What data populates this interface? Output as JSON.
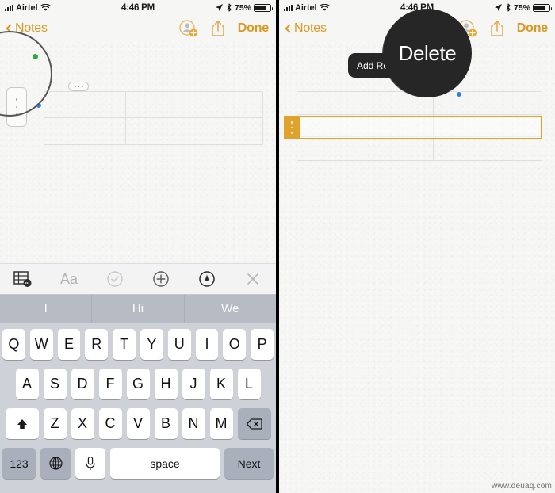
{
  "status_bar": {
    "carrier": "Airtel",
    "time": "4:46 PM",
    "battery_percent": "75%",
    "signal_icon": "signal-bars-icon",
    "wifi_icon": "wifi-icon",
    "location_icon": "location-arrow-icon",
    "bluetooth_icon": "bluetooth-icon",
    "battery_icon": "battery-icon",
    "battery_level": 75
  },
  "nav_bar": {
    "back_label": "Notes",
    "back_icon": "chevron-left-icon",
    "add_person_icon": "add-person-icon",
    "share_icon": "share-icon",
    "done_label": "Done"
  },
  "left_panel": {
    "table": {
      "columns": 2,
      "rows": 2,
      "cells": [
        [
          "",
          ""
        ],
        [
          "",
          ""
        ]
      ]
    },
    "column_handle_icon": "column-handle-dots-icon",
    "row_handle_icon": "row-handle-dots-icon",
    "selection_dot_blue": "selection-handle-dot",
    "annotation_dot_green": "annotation-start-dot"
  },
  "right_panel": {
    "table": {
      "columns": 2,
      "rows": 3,
      "cells": [
        [
          "",
          ""
        ],
        [
          "",
          ""
        ],
        [
          "",
          ""
        ]
      ]
    },
    "selected_row_index": 1,
    "row_handle_icon": "selected-row-handle-dots-icon",
    "selection_dot_blue": "selection-handle-dot",
    "annotation_dot_green": "annotation-start-dot",
    "popup_menu": {
      "items": [
        "Add Row",
        "Delete"
      ],
      "magnified_item": "Delete"
    }
  },
  "keyboard_toolbar": {
    "items": [
      {
        "name": "table-icon",
        "label": "",
        "active": true
      },
      {
        "name": "text-format-icon",
        "label": "Aa",
        "active": false
      },
      {
        "name": "checklist-icon",
        "label": "",
        "active": false
      },
      {
        "name": "add-attachment-icon",
        "label": "",
        "active": false
      },
      {
        "name": "markup-pen-icon",
        "label": "",
        "active": false
      },
      {
        "name": "close-keyboard-icon",
        "label": "",
        "active": false
      }
    ]
  },
  "predictive_text": [
    "I",
    "Hi",
    "We"
  ],
  "keyboard": {
    "row1": [
      "Q",
      "W",
      "E",
      "R",
      "T",
      "Y",
      "U",
      "I",
      "O",
      "P"
    ],
    "row2": [
      "A",
      "S",
      "D",
      "F",
      "G",
      "H",
      "J",
      "K",
      "L"
    ],
    "row3": [
      "Z",
      "X",
      "C",
      "V",
      "B",
      "N",
      "M"
    ],
    "shift_icon": "shift-up-arrow-icon",
    "backspace_icon": "backspace-delete-icon",
    "numbers_label": "123",
    "globe_icon": "globe-language-icon",
    "mic_icon": "microphone-icon",
    "space_label": "space",
    "return_label": "Next"
  },
  "watermark": "www.deuaq.com",
  "colors": {
    "accent_gold": "#d99a24",
    "selection_gold": "#dfa32b",
    "popup_dark": "#262626",
    "blue_handle": "#2a7ff0",
    "green_dot": "#2faa3f",
    "keyboard_bg": "#ced2d8",
    "predict_bg": "#b7bcc4",
    "paper_bg": "#f6f6f4"
  }
}
